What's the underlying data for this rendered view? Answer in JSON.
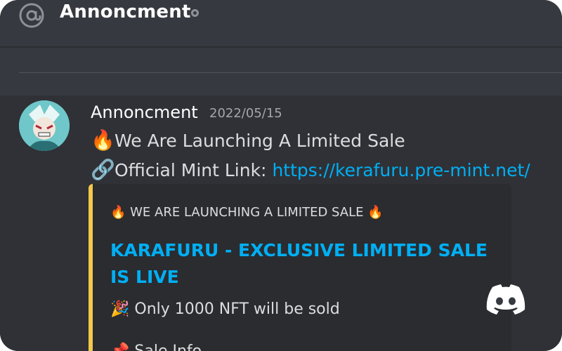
{
  "header": {
    "channel_title": "Annoncment"
  },
  "message": {
    "author": "Annoncment",
    "timestamp": "2022/05/15",
    "line1_emoji": "🔥",
    "line1_text": "We Are Launching A Limited Sale",
    "line2_emoji": "🔗",
    "line2_text": "Official Mint Link: ",
    "line2_link": "https://kerafuru.pre-mint.net/"
  },
  "embed": {
    "top_text": "🔥 WE ARE LAUNCHING A LIMITED SALE 🔥",
    "title": "KARAFURU - EXCLUSIVE LIMITED SALE IS LIVE",
    "description": "🎉 Only 1000 NFT will be sold",
    "description_partial": "📌 Sale Info",
    "accent_color": "#f4c84c"
  },
  "colors": {
    "background": "#36393f",
    "link": "#00aff4",
    "text": "#dcddde"
  },
  "icons": {
    "header_icon": "at-icon",
    "status_icon": "status-dot-icon",
    "brand_icon": "discord-logo-icon"
  }
}
